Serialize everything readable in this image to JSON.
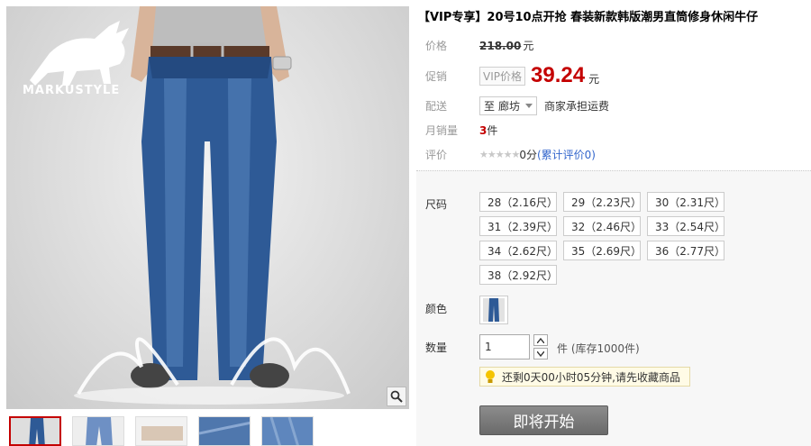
{
  "gallery": {
    "brand_text": "MARKUSTYLE",
    "thumb_count": 5
  },
  "product": {
    "title": "【VIP专享】20号10点开抢 春装新款韩版潮男直筒修身休闲牛仔",
    "price_label": "价格",
    "original_price": "218.00",
    "currency": "元",
    "promo_label": "促销",
    "vip_tag": "VIP价格",
    "promo_price": "39.24",
    "delivery_label": "配送",
    "delivery_prefix": "至",
    "delivery_location": "廊坊",
    "shipping_note": "商家承担运费",
    "monthly_sales_label": "月销量",
    "monthly_sales_value": "3",
    "monthly_sales_unit": "件",
    "rating_label": "评价",
    "rating_stars": "★★★★★",
    "rating_score": "0分",
    "review_link": "(累计评价0)"
  },
  "options": {
    "size_label": "尺码",
    "sizes": [
      "28（2.16尺）",
      "29（2.23尺）",
      "30（2.31尺）",
      "31（2.39尺）",
      "32（2.46尺）",
      "33（2.54尺）",
      "34（2.62尺）",
      "35（2.69尺）",
      "36（2.77尺）",
      "38（2.92尺）"
    ],
    "color_label": "颜色",
    "quantity_label": "数量",
    "quantity_value": "1",
    "quantity_unit": "件 (库存1000件)",
    "countdown_text": "还剩0天00小时05分钟,请先收藏商品",
    "start_button": "即将开始"
  },
  "colors": {
    "accent_red": "#c40000",
    "link_blue": "#3366cc",
    "button_gray": "#7a7a7a"
  }
}
